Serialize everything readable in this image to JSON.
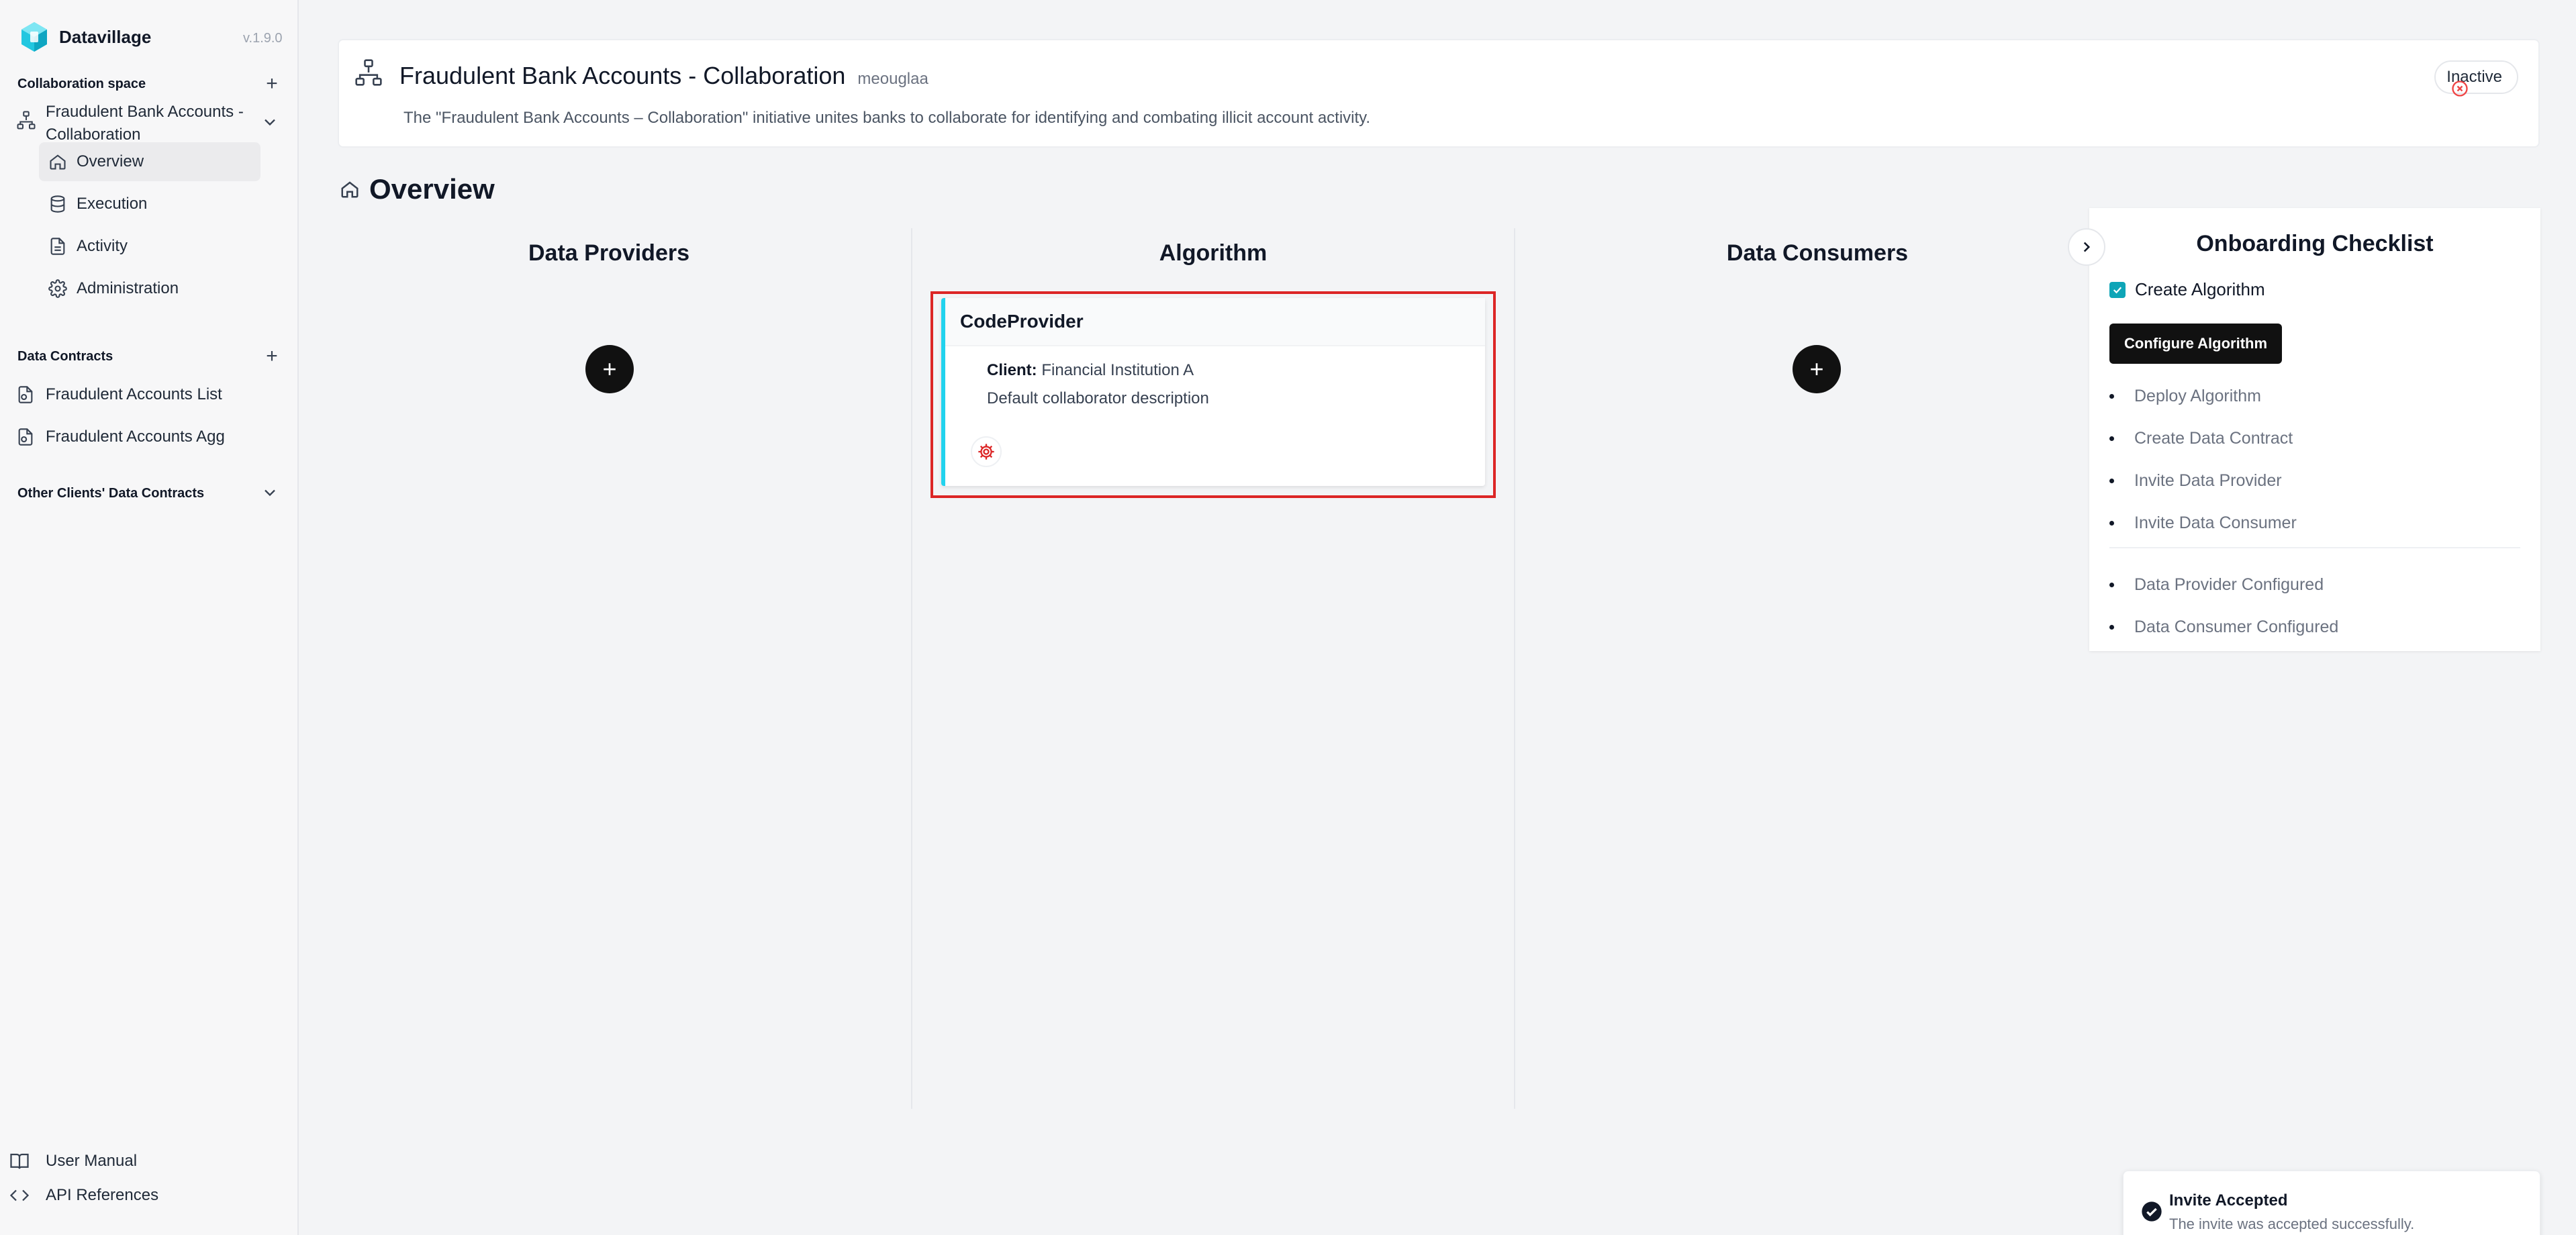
{
  "app": {
    "name": "Datavillage",
    "version": "v.1.9.0"
  },
  "sidebar": {
    "collab_section": "Collaboration space",
    "collab_name": "Fraudulent Bank Accounts - Collaboration",
    "nav": [
      {
        "label": "Overview",
        "icon": "home-icon",
        "active": true
      },
      {
        "label": "Execution",
        "icon": "database-icon"
      },
      {
        "label": "Activity",
        "icon": "file-icon"
      },
      {
        "label": "Administration",
        "icon": "gear-icon"
      }
    ],
    "contracts_section": "Data Contracts",
    "contracts": [
      {
        "label": "Fraudulent Accounts List",
        "icon": "file-contract-icon"
      },
      {
        "label": "Fraudulent Accounts Agg",
        "icon": "file-contract-icon"
      }
    ],
    "other_section": "Other Clients' Data Contracts",
    "footer": [
      {
        "label": "User Manual",
        "icon": "book-icon"
      },
      {
        "label": "API References",
        "icon": "code-icon"
      }
    ]
  },
  "header": {
    "title": "Fraudulent Bank Accounts - Collaboration",
    "slug": "meouglaa",
    "description": "The \"Fraudulent Bank Accounts – Collaboration\" initiative unites banks to collaborate for identifying and combating illicit account activity.",
    "status": "Inactive"
  },
  "page": {
    "title": "Overview"
  },
  "columns": {
    "providers": {
      "title": "Data Providers"
    },
    "algorithm": {
      "title": "Algorithm",
      "card": {
        "name": "CodeProvider",
        "client_label": "Client:",
        "client_value": "Financial Institution A",
        "description": "Default collaborator description"
      }
    },
    "consumers": {
      "title": "Data Consumers"
    }
  },
  "onboarding": {
    "title": "Onboarding Checklist",
    "done_item": "Create Algorithm",
    "button": "Configure Algorithm",
    "items": [
      "Deploy Algorithm",
      "Create Data Contract",
      "Invite Data Provider",
      "Invite Data Consumer"
    ],
    "items2": [
      "Data Provider Configured",
      "Data Consumer Configured"
    ]
  },
  "toast": {
    "title": "Invite Accepted",
    "message": "The invite was accepted successfully."
  },
  "colors": {
    "accent": "#22d3ee",
    "highlight": "#dc2626",
    "status_red": "#ef4444",
    "checkbox": "#0ea5b7"
  }
}
